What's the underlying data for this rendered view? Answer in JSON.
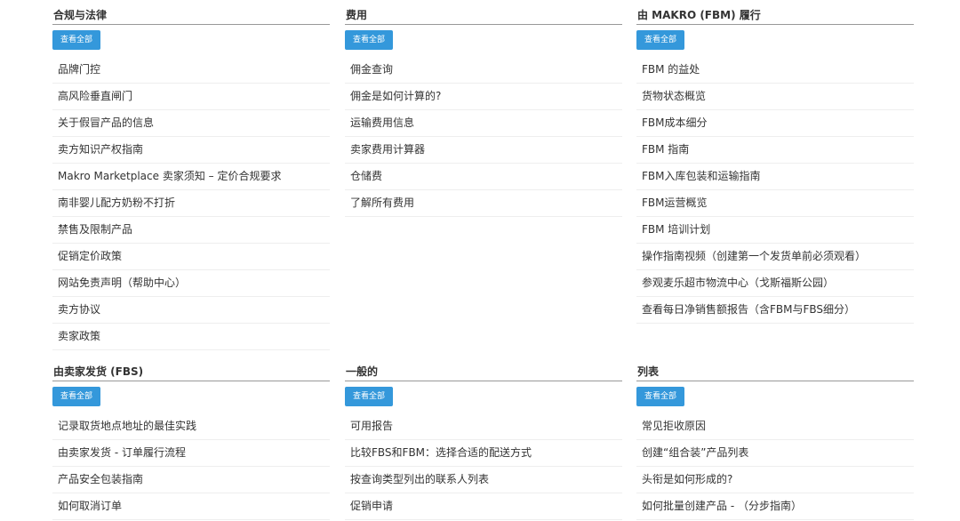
{
  "sections": [
    {
      "title": "合规与法律",
      "view_all": "查看全部",
      "items": [
        "品牌门控",
        "高风险垂直闸门",
        "关于假冒产品的信息",
        "卖方知识产权指南",
        "Makro Marketplace 卖家须知 – 定价合规要求",
        "南非婴儿配方奶粉不打折",
        "禁售及限制产品",
        "促销定价政策",
        "网站免责声明（帮助中心）",
        "卖方协议",
        "卖家政策"
      ]
    },
    {
      "title": "费用",
      "view_all": "查看全部",
      "items": [
        "佣金查询",
        "佣金是如何计算的?",
        "运输费用信息",
        "卖家费用计算器",
        "仓储费",
        "了解所有费用"
      ]
    },
    {
      "title": "由 MAKRO (FBM) 履行",
      "view_all": "查看全部",
      "items": [
        "FBM 的益处",
        "货物状态概览",
        "FBM成本细分",
        "FBM 指南",
        "FBM入库包装和运输指南",
        "FBM运营概览",
        "FBM 培训计划",
        "操作指南视频（创建第一个发货单前必须观看）",
        "参观麦乐超市物流中心（戈斯福斯公园）",
        "查看每日净销售额报告（含FBM与FBS细分）"
      ]
    },
    {
      "title": "由卖家发货 (FBS)",
      "view_all": "查看全部",
      "items": [
        "记录取货地点地址的最佳实践",
        "由卖家发货 - 订单履行流程",
        "产品安全包装指南",
        "如何取消订单"
      ]
    },
    {
      "title": "一般的",
      "view_all": "查看全部",
      "items": [
        "可用报告",
        "比较FBS和FBM：选择合适的配送方式",
        "按查询类型列出的联系人列表",
        "促销申请"
      ]
    },
    {
      "title": "列表",
      "view_all": "查看全部",
      "items": [
        "常见拒收原因",
        "创建“组合装”产品列表",
        "头衔是如何形成的?",
        "如何批量创建产品 - （分步指南）"
      ]
    }
  ],
  "colors": {
    "button": "#3498db",
    "text": "#333333",
    "divider": "#eeeeee"
  }
}
